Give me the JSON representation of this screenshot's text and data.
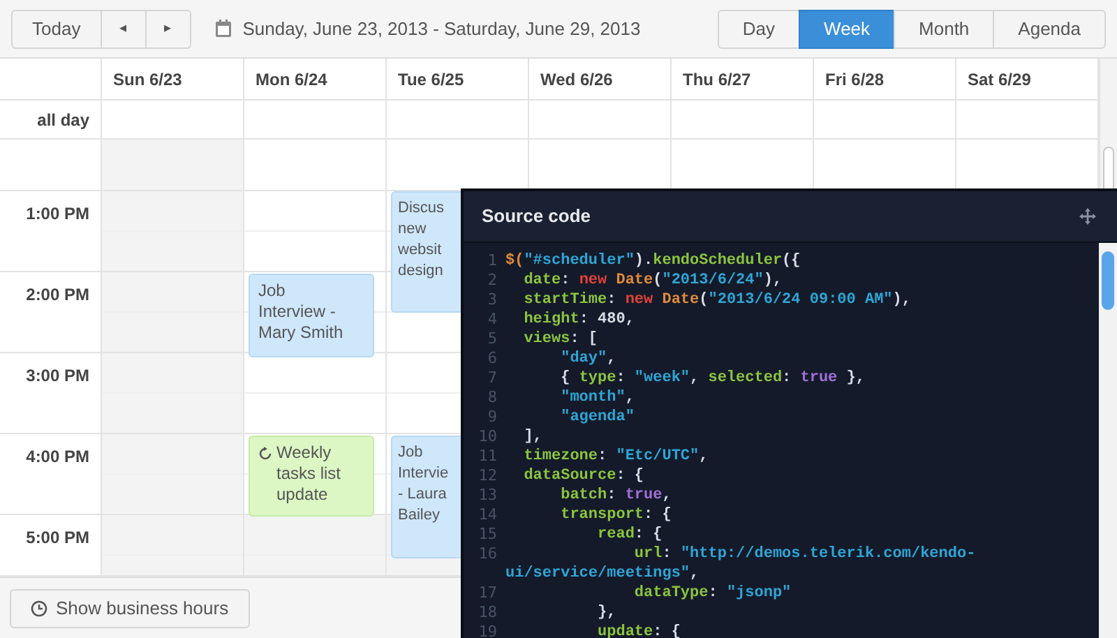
{
  "toolbar": {
    "today": "Today",
    "prev": "◂",
    "next": "▸",
    "date_range": "Sunday, June 23, 2013 - Saturday, June 29, 2013",
    "views": [
      {
        "label": "Day",
        "selected": false
      },
      {
        "label": "Week",
        "selected": true
      },
      {
        "label": "Month",
        "selected": false
      },
      {
        "label": "Agenda",
        "selected": false
      }
    ]
  },
  "all_day_label": "all day",
  "days": [
    {
      "label": "Sun 6/23",
      "nonbusiness": true
    },
    {
      "label": "Mon 6/24",
      "events": [
        {
          "title": "Job Interview - Mary Smith",
          "kind": "meeting"
        },
        {
          "title": "Weekly tasks list update",
          "kind": "recurring"
        }
      ]
    },
    {
      "label": "Tue 6/25",
      "events": [
        {
          "title": "Discus new websit design",
          "kind": "meeting"
        },
        {
          "title": "Job Intervie - Laura Bailey",
          "kind": "meeting"
        }
      ]
    },
    {
      "label": "Wed 6/26"
    },
    {
      "label": "Thu 6/27"
    },
    {
      "label": "Fri 6/28"
    },
    {
      "label": "Sat 6/29"
    }
  ],
  "hours": [
    {
      "label": "1:00 PM",
      "nonbusiness": false
    },
    {
      "label": "2:00 PM",
      "nonbusiness": false
    },
    {
      "label": "3:00 PM",
      "nonbusiness": false
    },
    {
      "label": "4:00 PM",
      "nonbusiness": false
    },
    {
      "label": "5:00 PM",
      "nonbusiness": true
    }
  ],
  "footer": {
    "button": "Show business hours"
  },
  "source_panel": {
    "title": "Source code",
    "lines": [
      {
        "number": "1",
        "tokens": [
          {
            "kind": "func",
            "text": "$("
          },
          {
            "kind": "string",
            "text": "\"#scheduler\""
          },
          {
            "kind": "plain",
            "text": ")."
          },
          {
            "kind": "key",
            "text": "kendoScheduler"
          },
          {
            "kind": "plain",
            "text": "({"
          }
        ]
      },
      {
        "number": "2",
        "tokens": [
          {
            "kind": "key",
            "text": "  date"
          },
          {
            "kind": "plain",
            "text": ": "
          },
          {
            "kind": "keyword",
            "text": "new "
          },
          {
            "kind": "func",
            "text": "Date"
          },
          {
            "kind": "plain",
            "text": "("
          },
          {
            "kind": "string",
            "text": "\"2013/6/24\""
          },
          {
            "kind": "plain",
            "text": "),"
          }
        ]
      },
      {
        "number": "3",
        "tokens": [
          {
            "kind": "key",
            "text": "  startTime"
          },
          {
            "kind": "plain",
            "text": ": "
          },
          {
            "kind": "keyword",
            "text": "new "
          },
          {
            "kind": "func",
            "text": "Date"
          },
          {
            "kind": "plain",
            "text": "("
          },
          {
            "kind": "string",
            "text": "\"2013/6/24 09:00 AM\""
          },
          {
            "kind": "plain",
            "text": "),"
          }
        ]
      },
      {
        "number": "4",
        "tokens": [
          {
            "kind": "key",
            "text": "  height"
          },
          {
            "kind": "plain",
            "text": ": 480,"
          }
        ]
      },
      {
        "number": "5",
        "tokens": [
          {
            "kind": "key",
            "text": "  views"
          },
          {
            "kind": "plain",
            "text": ": ["
          }
        ]
      },
      {
        "number": "6",
        "tokens": [
          {
            "kind": "string",
            "text": "      \"day\""
          },
          {
            "kind": "plain",
            "text": ","
          }
        ]
      },
      {
        "number": "7",
        "tokens": [
          {
            "kind": "plain",
            "text": "      { "
          },
          {
            "kind": "key",
            "text": "type"
          },
          {
            "kind": "plain",
            "text": ": "
          },
          {
            "kind": "string",
            "text": "\"week\""
          },
          {
            "kind": "plain",
            "text": ", "
          },
          {
            "kind": "key",
            "text": "selected"
          },
          {
            "kind": "plain",
            "text": ": "
          },
          {
            "kind": "bool",
            "text": "true"
          },
          {
            "kind": "plain",
            "text": " },"
          }
        ]
      },
      {
        "number": "8",
        "tokens": [
          {
            "kind": "string",
            "text": "      \"month\""
          },
          {
            "kind": "plain",
            "text": ","
          }
        ]
      },
      {
        "number": "9",
        "tokens": [
          {
            "kind": "string",
            "text": "      \"agenda\""
          }
        ]
      },
      {
        "number": "10",
        "tokens": [
          {
            "kind": "plain",
            "text": "  ],"
          }
        ]
      },
      {
        "number": "11",
        "tokens": [
          {
            "kind": "key",
            "text": "  timezone"
          },
          {
            "kind": "plain",
            "text": ": "
          },
          {
            "kind": "string",
            "text": "\"Etc/UTC\""
          },
          {
            "kind": "plain",
            "text": ","
          }
        ]
      },
      {
        "number": "12",
        "tokens": [
          {
            "kind": "key",
            "text": "  dataSource"
          },
          {
            "kind": "plain",
            "text": ": {"
          }
        ]
      },
      {
        "number": "13",
        "tokens": [
          {
            "kind": "key",
            "text": "      batch"
          },
          {
            "kind": "plain",
            "text": ": "
          },
          {
            "kind": "bool",
            "text": "true"
          },
          {
            "kind": "plain",
            "text": ","
          }
        ]
      },
      {
        "number": "14",
        "tokens": [
          {
            "kind": "key",
            "text": "      transport"
          },
          {
            "kind": "plain",
            "text": ": {"
          }
        ]
      },
      {
        "number": "15",
        "tokens": [
          {
            "kind": "key",
            "text": "          read"
          },
          {
            "kind": "plain",
            "text": ": {"
          }
        ]
      },
      {
        "number": "16",
        "tokens": [
          {
            "kind": "key",
            "text": "              url"
          },
          {
            "kind": "plain",
            "text": ": "
          },
          {
            "kind": "string",
            "text": "\"http://demos.telerik.com/kendo-ui/service/meetings\""
          },
          {
            "kind": "plain",
            "text": ","
          }
        ]
      },
      {
        "number": "17",
        "tokens": [
          {
            "kind": "key",
            "text": "              dataType"
          },
          {
            "kind": "plain",
            "text": ": "
          },
          {
            "kind": "string",
            "text": "\"jsonp\""
          }
        ]
      },
      {
        "number": "18",
        "tokens": [
          {
            "kind": "plain",
            "text": "          },"
          }
        ]
      },
      {
        "number": "19",
        "tokens": [
          {
            "kind": "key",
            "text": "          update"
          },
          {
            "kind": "plain",
            "text": ": {"
          }
        ]
      }
    ]
  }
}
